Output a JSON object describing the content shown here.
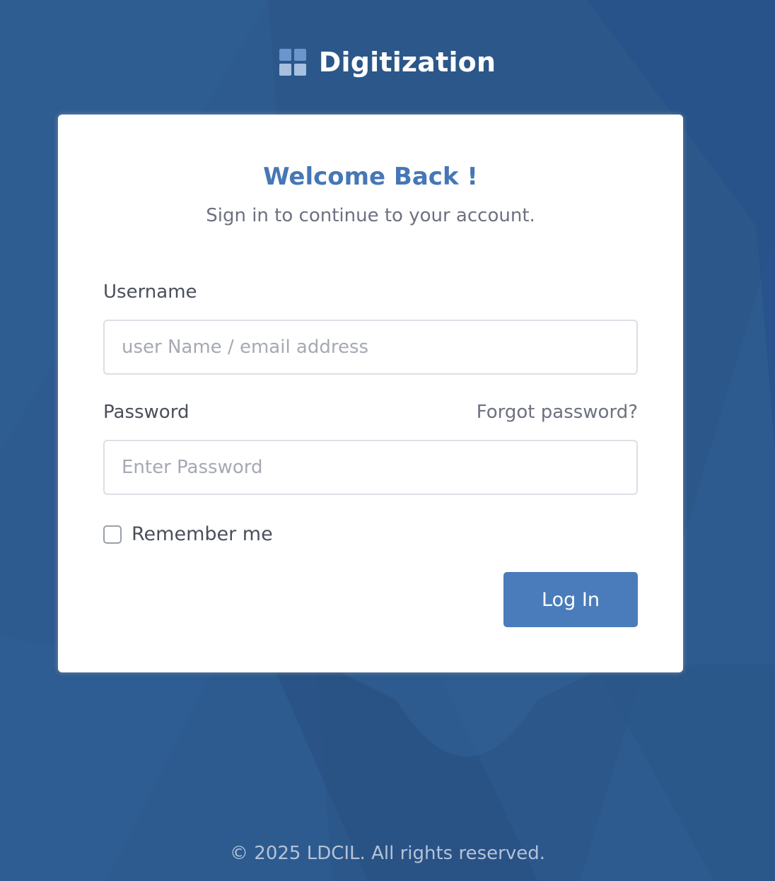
{
  "brand": {
    "name": "Digitization",
    "icon": "grid-squares-icon"
  },
  "login_card": {
    "title": "Welcome Back !",
    "subtitle": "Sign in to continue to your account.",
    "username_label": "Username",
    "username_value": "",
    "username_placeholder": "user Name / email address",
    "password_label": "Password",
    "forgot_password_link": "Forgot password?",
    "password_value": "",
    "password_placeholder": "Enter Password",
    "remember_me_label": "Remember me",
    "remember_me_checked": false,
    "login_button_label": "Log In"
  },
  "footer": {
    "text": "© 2025 LDCIL. All rights reserved."
  },
  "colors": {
    "background": "#2d5b8f",
    "background_shape_dark": "#264f80",
    "background_shape_light": "#33649a",
    "brand_icon_light": "#a7c0df",
    "brand_icon_dark": "#6b95cc",
    "title": "#4677b6",
    "button": "#4a7cbb",
    "text_muted": "#6d7180",
    "footer_text": "#b4c3d8"
  }
}
